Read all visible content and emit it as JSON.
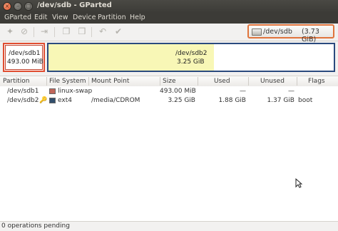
{
  "window": {
    "title": "/dev/sdb - GParted"
  },
  "titlebar_buttons": {
    "close": "×",
    "minimize": "–",
    "maximize": "□"
  },
  "menu": [
    "GParted",
    "Edit",
    "View",
    "Device",
    "Partition",
    "Help"
  ],
  "toolbar": {
    "icons": [
      "new-partition-icon",
      "delete-icon",
      "resize-move-icon",
      "copy-icon",
      "paste-icon",
      "undo-icon",
      "apply-icon"
    ],
    "glyphs": [
      "✦",
      "⊘",
      "⇥",
      "❐",
      "❒",
      "↶",
      "✔"
    ]
  },
  "device_selector": {
    "device": "/dev/sdb",
    "size": "(3.73 GiB)"
  },
  "disk_map": {
    "partitions": [
      {
        "name": "/dev/sdb1",
        "size": "493.00 MiB"
      },
      {
        "name": "/dev/sdb2",
        "size": "3.25 GiB"
      }
    ]
  },
  "table": {
    "headers": [
      "Partition",
      "File System",
      "Mount Point",
      "Size",
      "Used",
      "Unused",
      "Flags"
    ],
    "rows": [
      {
        "partition": "/dev/sdb1",
        "filesystem": "linux-swap",
        "fs_color": "#c1665a",
        "mount": "",
        "size": "493.00 MiB",
        "used": "—",
        "unused": "—",
        "flags": ""
      },
      {
        "partition": "/dev/sdb2",
        "filesystem": "ext4",
        "fs_color": "#314e6c",
        "mount": "/media/CDROM",
        "size": "3.25 GiB",
        "used": "1.88 GiB",
        "unused": "1.37 GiB",
        "flags": "boot"
      }
    ]
  },
  "status": {
    "text": "0 operations pending"
  }
}
